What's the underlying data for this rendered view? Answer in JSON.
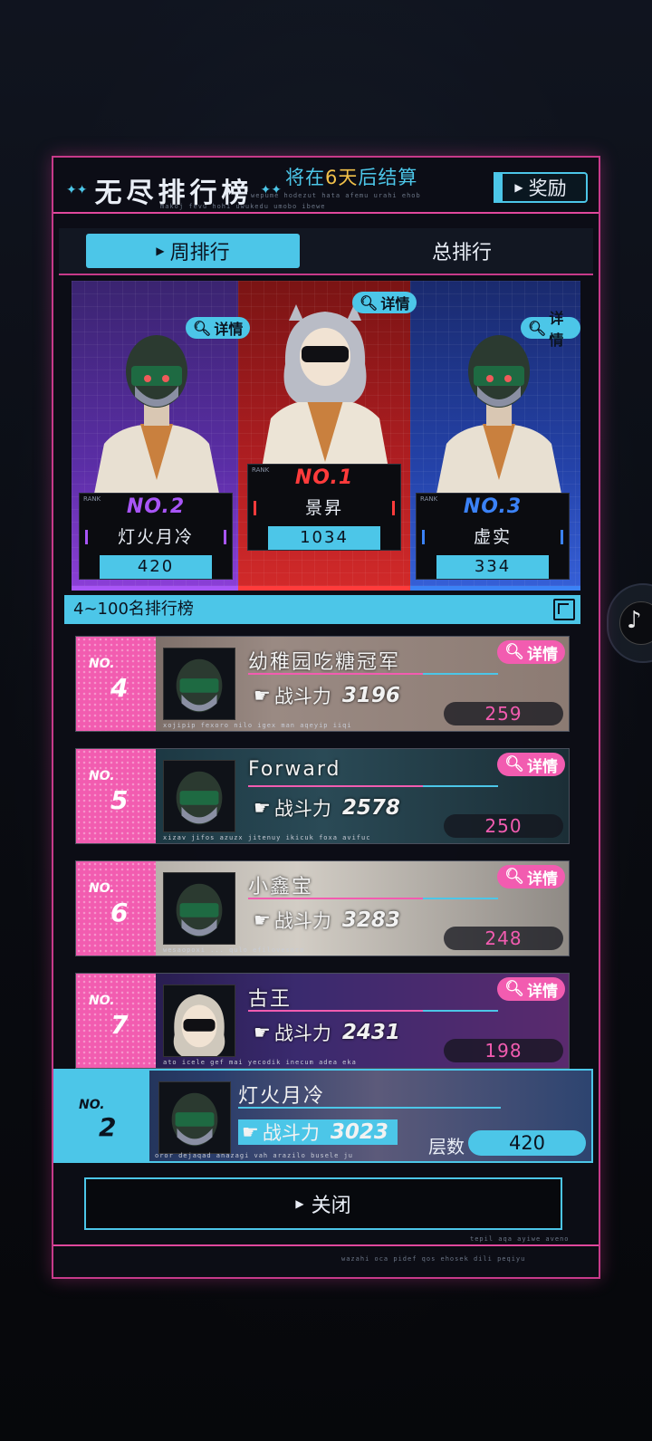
{
  "header": {
    "title": "无尽排行榜",
    "settle_prefix": "将在",
    "settle_days": "6天",
    "settle_suffix": "后结算",
    "tiny_line_1": "wepume hodezut hata afemu urahi ehob",
    "tiny_line_2": "makoj fevu hohi uwukedu umobo ibewe",
    "reward_label": "奖励"
  },
  "tabs": [
    {
      "label": "周排行",
      "active": true
    },
    {
      "label": "总排行",
      "active": false
    }
  ],
  "podium": {
    "rank_label": "RANK",
    "detail_label": "详情",
    "entries": [
      {
        "rank": "NO.2",
        "name": "灯火月冷",
        "score": "420",
        "color": "#a855f7"
      },
      {
        "rank": "NO.1",
        "name": "景昇",
        "score": "1034",
        "color": "#ff3b3b"
      },
      {
        "rank": "NO.3",
        "name": "虚实",
        "score": "334",
        "color": "#3b82f6"
      }
    ]
  },
  "list": {
    "header": "4~100名排行榜",
    "no_label": "NO.",
    "power_label": "战斗力",
    "detail_label": "详情",
    "entries": [
      {
        "no": "4",
        "name": "幼稚园吃糖冠军",
        "power": "3196",
        "layer": "259",
        "tiny": "xojipip fexoro nilo igex man aqeyip iiqi"
      },
      {
        "no": "5",
        "name": "Forward",
        "power": "2578",
        "layer": "250",
        "tiny": "xizav jifos azuzx jitenuy ikicuk foxa avifuc"
      },
      {
        "no": "6",
        "name": "小鑫宝",
        "power": "3283",
        "layer": "248",
        "tiny": "wesaopoxi ... qulo efilovesoco"
      },
      {
        "no": "7",
        "name": "古王",
        "power": "2431",
        "layer": "198",
        "tiny": "ato icele gef mai yecodik inecum adea eka"
      }
    ]
  },
  "mine": {
    "no_label": "NO.",
    "no": "2",
    "name": "灯火月冷",
    "power_label": "战斗力",
    "power": "3023",
    "layer_label": "层数",
    "layer": "420",
    "tiny": "oror dejaqad anazagi vah arazilo busele ju"
  },
  "footer": {
    "close_label": "关闭",
    "tiny_line_1": "tepil aqa ayiwe aveno",
    "tiny_line_2": "wazahi oca pidef qos ehosek dili peqiyu"
  },
  "colors": {
    "accent": "#4cc6e8",
    "pink": "#f25cb0",
    "frame": "#c73a8a"
  }
}
